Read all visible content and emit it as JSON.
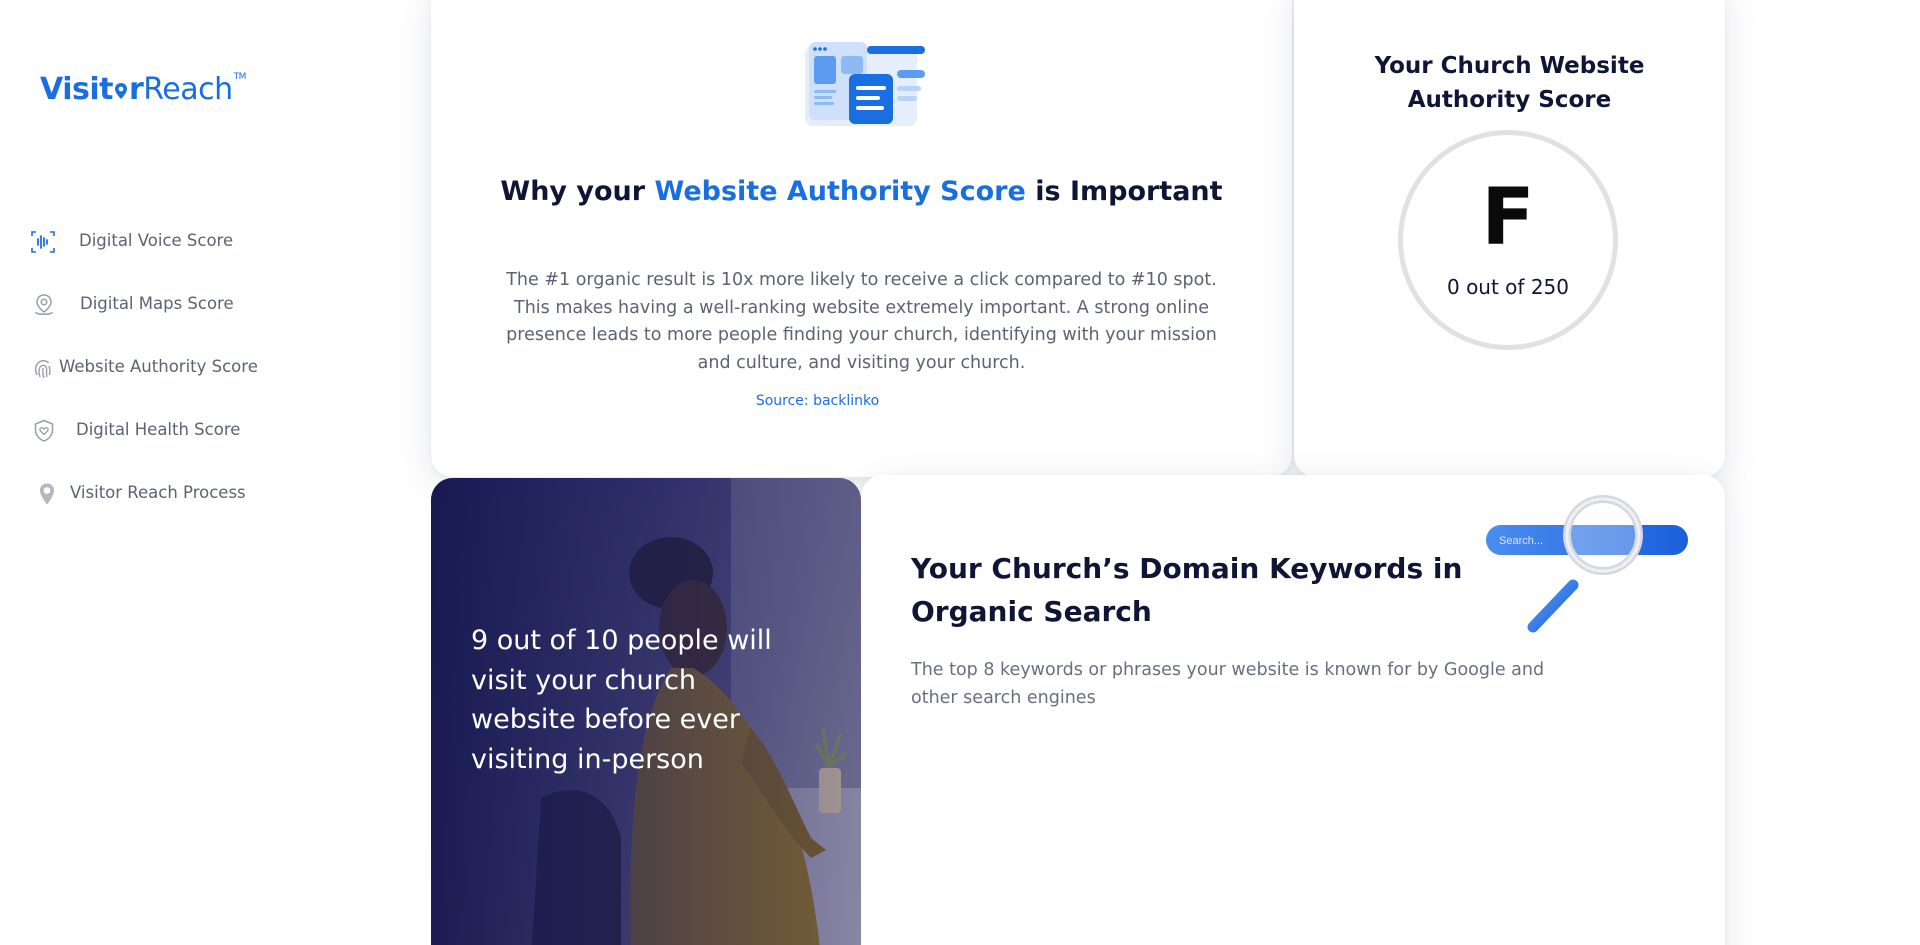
{
  "brand": {
    "name_part1": "Visit",
    "name_part2": "r",
    "name_part3": "Reach",
    "trademark": "TM",
    "color": "#1a6fe0"
  },
  "sidebar": {
    "items": [
      {
        "label": "Digital Voice Score",
        "icon": "voice-waveform-icon"
      },
      {
        "label": "Digital Maps Score",
        "icon": "map-pin-icon"
      },
      {
        "label": "Website Authority Score",
        "icon": "fingerprint-icon",
        "active": true
      },
      {
        "label": "Digital Health Score",
        "icon": "shield-heart-icon"
      },
      {
        "label": "Visitor Reach Process",
        "icon": "location-pin-icon"
      }
    ]
  },
  "why": {
    "title_prefix": "Why your ",
    "title_accent": "Website Authority Score",
    "title_suffix": " is Important",
    "body": "The #1 organic result is 10x more likely to receive a click compared to #10 spot. This makes having a well-ranking website extremely important. A strong online presence leads to more people finding your church, identifying with your mission and culture, and visiting your church.",
    "source": "Source: backlinko"
  },
  "score": {
    "title": "Your Church Website Authority Score",
    "grade": "F",
    "value_text": "0 out of 250"
  },
  "photo_card": {
    "text": "9 out of 10 people will visit your church website before ever visiting in-person"
  },
  "keywords": {
    "title": "Your Church’s Domain Keywords in Organic Search",
    "subtitle": "The top 8 keywords or phrases your website is known for by Google and other search engines",
    "search_placeholder": "Search..."
  },
  "colors": {
    "accent": "#1a6fe0",
    "heading": "#0f1535",
    "body": "#5d6274",
    "ring": "#e1e1e4"
  }
}
